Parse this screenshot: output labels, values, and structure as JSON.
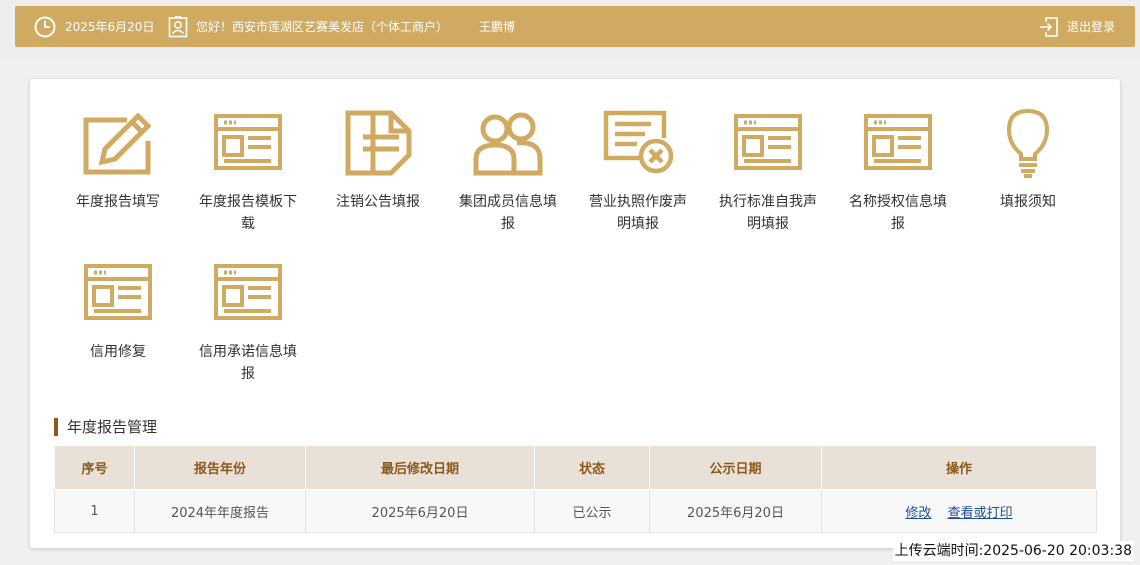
{
  "header": {
    "date": "2025年6月20日",
    "greeting": "您好！西安市莲湖区艺赛美发店（个体工商户）",
    "username": "王鹏博",
    "logout_label": "退出登录",
    "accent_color": "#cfaa60"
  },
  "tiles": [
    {
      "label": "年度报告填写",
      "icon": "edit-form-icon"
    },
    {
      "label": "年度报告模板下载",
      "icon": "document-template-icon"
    },
    {
      "label": "注销公告填报",
      "icon": "cancel-notice-icon"
    },
    {
      "label": "集团成员信息填报",
      "icon": "group-members-icon"
    },
    {
      "label": "营业执照作废声明填报",
      "icon": "license-void-icon"
    },
    {
      "label": "执行标准自我声明填报",
      "icon": "document-standard-icon"
    },
    {
      "label": "名称授权信息填报",
      "icon": "document-authorization-icon"
    },
    {
      "label": "填报须知",
      "icon": "lightbulb-icon"
    },
    {
      "label": "信用修复",
      "icon": "document-credit-icon"
    },
    {
      "label": "信用承诺信息填报",
      "icon": "document-commitment-icon"
    }
  ],
  "section": {
    "title": "年度报告管理"
  },
  "table": {
    "columns": [
      "序号",
      "报告年份",
      "最后修改日期",
      "状态",
      "公示日期",
      "操作"
    ],
    "rows": [
      {
        "index": "1",
        "year": "2024年年度报告",
        "modified": "2025年6月20日",
        "status": "已公示",
        "published": "2025年6月20日",
        "actions": [
          "修改",
          "查看或打印"
        ]
      }
    ]
  },
  "footer": {
    "upload_time": "上传云端时间:2025-06-20 20:03:38"
  }
}
